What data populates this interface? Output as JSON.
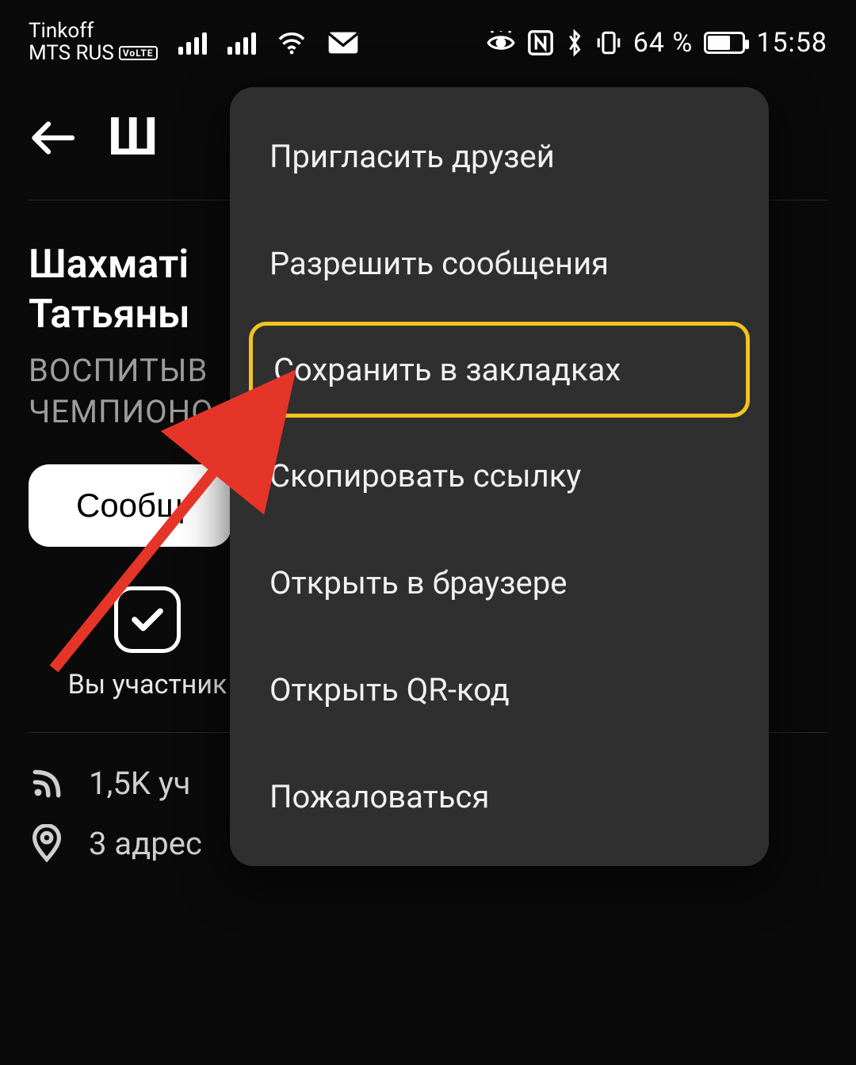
{
  "status": {
    "carrier_top": "Tinkoff",
    "carrier_bottom": "MTS RUS",
    "volte": "VoLTE",
    "battery_percent": "64 %",
    "time": "15:58"
  },
  "header": {
    "title_partial": "Ш"
  },
  "group": {
    "title_line1": "Шахматі",
    "title_line2": "Татьяны",
    "subtitle_line1": "ВОСПИТЫВ",
    "subtitle_line2": "ЧЕМПИОНО"
  },
  "buttons": {
    "message": "Сообщ"
  },
  "membership": {
    "label": "Вы участник"
  },
  "info": {
    "followers": "1,5K уч",
    "address": "3 адрес"
  },
  "menu": {
    "items": [
      "Пригласить друзей",
      "Разрешить сообщения",
      "Сохранить в закладках",
      "Скопировать ссылку",
      "Открыть в браузере",
      "Открыть QR-код",
      "Пожаловаться"
    ],
    "highlight_index": 2
  }
}
